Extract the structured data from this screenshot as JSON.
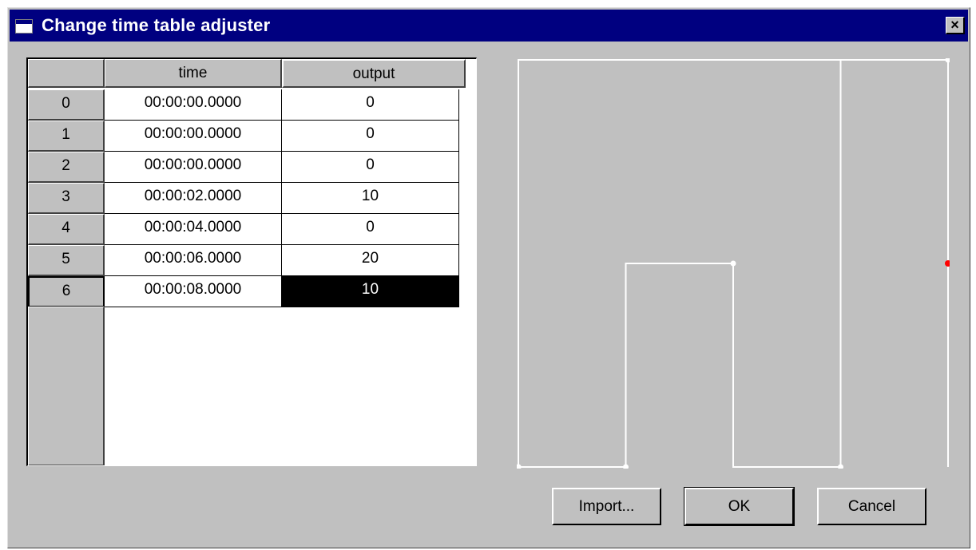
{
  "window": {
    "title": "Change time table adjuster",
    "close_glyph": "×"
  },
  "table": {
    "columns": [
      "time",
      "output"
    ],
    "rows": [
      {
        "index": "0",
        "time": "00:00:00.0000",
        "output": "0"
      },
      {
        "index": "1",
        "time": "00:00:00.0000",
        "output": "0"
      },
      {
        "index": "2",
        "time": "00:00:00.0000",
        "output": "0"
      },
      {
        "index": "3",
        "time": "00:00:02.0000",
        "output": "10"
      },
      {
        "index": "4",
        "time": "00:00:04.0000",
        "output": "0"
      },
      {
        "index": "5",
        "time": "00:00:06.0000",
        "output": "20"
      },
      {
        "index": "6",
        "time": "00:00:08.0000",
        "output": "10"
      }
    ],
    "selected_row": 6,
    "selected_column": "output"
  },
  "plot": {
    "points": [
      {
        "t": 0,
        "value": 0
      },
      {
        "t": 0,
        "value": 0
      },
      {
        "t": 0,
        "value": 0
      },
      {
        "t": 2,
        "value": 10
      },
      {
        "t": 4,
        "value": 0
      },
      {
        "t": 6,
        "value": 20
      },
      {
        "t": 8,
        "value": 10
      }
    ],
    "t_range": [
      0,
      8
    ],
    "value_range": [
      0,
      20
    ],
    "line_color": "#ffffff",
    "point_color": "#ffffff",
    "selected_point_color": "#ff0000"
  },
  "buttons": {
    "import_label": "Import...",
    "ok_label": "OK",
    "cancel_label": "Cancel"
  }
}
